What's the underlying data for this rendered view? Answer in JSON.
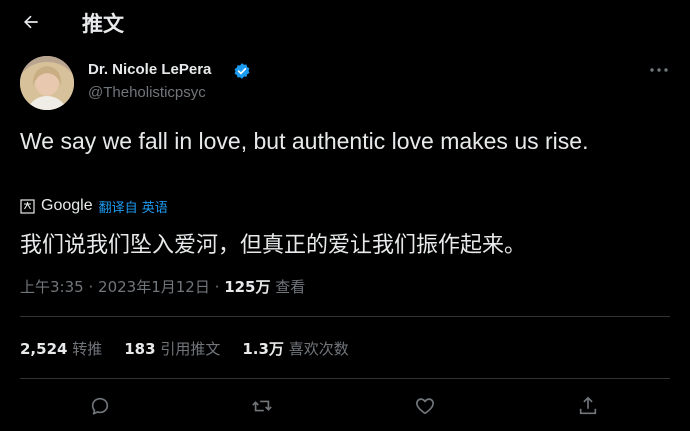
{
  "header": {
    "title": "推文",
    "back_icon": "arrow-left-icon"
  },
  "author": {
    "name": "Dr. Nicole LePera",
    "handle": "@Theholisticpsyc",
    "verified_icon": "verified-badge-icon",
    "verified_color": "#1d9bf0"
  },
  "tweet": {
    "text": "We say we fall in love, but authentic love makes us rise.",
    "translation_provider": "Google",
    "translate_label": "翻译自 英语",
    "translated_text": "我们说我们坠入爱河，但真正的爱让我们振作起来。"
  },
  "meta": {
    "time": "上午3:35",
    "separator": "·",
    "date": "2023年1月12日",
    "views_count": "125万",
    "views_label": "查看"
  },
  "stats": {
    "retweets_count": "2,524",
    "retweets_label": "转推",
    "quotes_count": "183",
    "quotes_label": "引用推文",
    "likes_count": "1.3万",
    "likes_label": "喜欢次数"
  },
  "actions": [
    "reply-icon",
    "retweet-icon",
    "like-icon",
    "share-icon"
  ],
  "colors": {
    "background": "#000000",
    "text_primary": "#e7e9ea",
    "text_secondary": "#71767b",
    "accent": "#1d9bf0",
    "divider": "#2f3336"
  }
}
